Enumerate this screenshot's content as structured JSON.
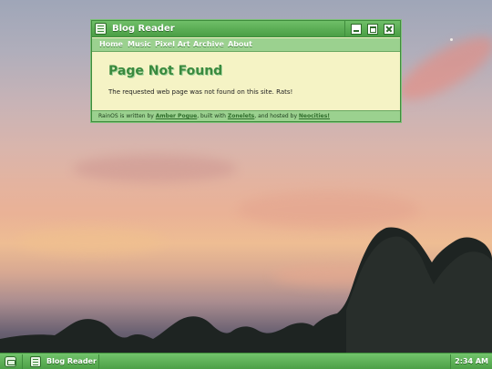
{
  "window": {
    "title": "Blog Reader",
    "icon": "blog-reader-icon",
    "controls": [
      "minimize-icon",
      "maximize-icon",
      "close-icon"
    ]
  },
  "menu": {
    "items": [
      {
        "label": "Home"
      },
      {
        "label": "Music"
      },
      {
        "label": "Pixel Art"
      },
      {
        "label": "Archive"
      },
      {
        "label": "About"
      }
    ]
  },
  "content": {
    "heading": "Page Not Found",
    "body": "The requested web page was not found on this site. Rats!"
  },
  "status": {
    "prefix": "RainOS is written by ",
    "author_link": "Amber Pogue",
    "middle": ", built with ",
    "built_link": "Zonelets",
    "middle2": ", and hosted by ",
    "host_link": "Neocities!"
  },
  "taskbar": {
    "start_icon": "rainos-start-icon",
    "task_label": "Blog Reader",
    "clock": "2:34 AM"
  },
  "colors": {
    "accent": "#4da047",
    "window_bg": "#f5f3c5",
    "heading": "#3a8a3e",
    "menu_bg": "#9bd18f"
  }
}
